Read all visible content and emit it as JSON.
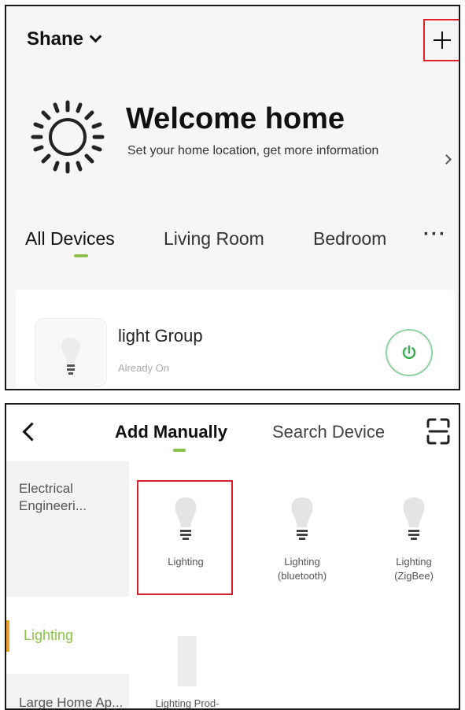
{
  "top": {
    "home_name": "Shane",
    "welcome_title": "Welcome home",
    "welcome_subtitle": "Set your home location, get more information",
    "tabs": [
      "All Devices",
      "Living Room",
      "Bedroom"
    ],
    "more": "···",
    "device": {
      "name": "light Group",
      "status": "Already On"
    }
  },
  "bottom": {
    "tabs": [
      "Add Manually",
      "Search Device"
    ],
    "categories": [
      "Electrical Engineeri...",
      "Lighting",
      "Large Home Ap..."
    ],
    "products": [
      "Lighting",
      "Lighting (bluetooth)",
      "Lighting (ZigBee)",
      "Lighting Prod-"
    ]
  },
  "colors": {
    "accent": "#8bc34a",
    "highlight_box": "#e0202a",
    "category_bar": "#f0a030"
  }
}
